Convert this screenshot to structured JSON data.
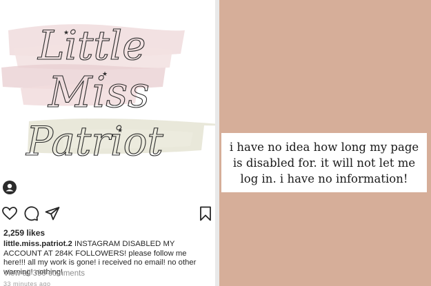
{
  "post": {
    "image_text": {
      "line1": "Little",
      "line2": "Miss",
      "line3": "Patriot"
    },
    "likes": "2,259 likes",
    "username": "little.miss.patriot.2",
    "caption": "INSTAGRAM DISABLED MY ACCOUNT AT 284K FOLLOWERS! please follow me here!!! all my work is gone! i received no email! no other warning! nothing!",
    "comments_link": "View all 390 comments",
    "timestamp": "33 minutes ago",
    "icons": [
      "avatar",
      "heart-icon",
      "comment-icon",
      "share-icon",
      "bookmark-icon"
    ]
  },
  "story": {
    "background_color": "#d6ae99",
    "text": "i have no idea how long my page is disabled for. it will not let me log in. i have no information!"
  }
}
